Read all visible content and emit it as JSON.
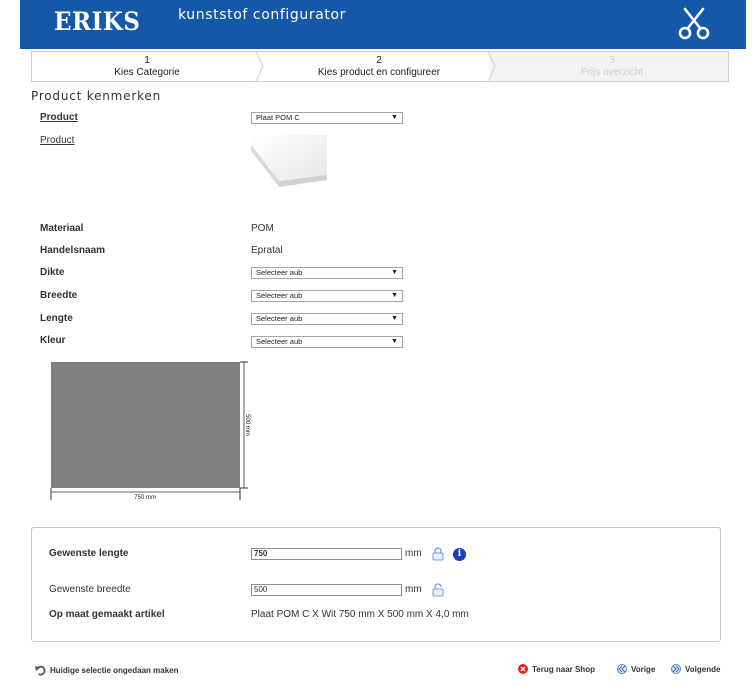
{
  "header": {
    "logo": "ERIKS",
    "title": "kunststof configurator",
    "icon": "scissors-icon",
    "color": "#1558a8"
  },
  "steps": [
    {
      "num": "1",
      "label": "Kies Categorie",
      "state": "done"
    },
    {
      "num": "2",
      "label": "Kies product en configureer",
      "state": "active"
    },
    {
      "num": "3",
      "label": "Prijs overzicht",
      "state": "disabled"
    }
  ],
  "section_title": "Product kenmerken",
  "product": {
    "label": "Product",
    "select_value": "Plaat POM C",
    "image_label": "Product"
  },
  "specs": {
    "materiaal_label": "Materiaal",
    "materiaal_value": "POM",
    "handelsnaam_label": "Handelsnaam",
    "handelsnaam_value": "Epratal",
    "dikte_label": "Dikte",
    "dikte_value": "Selecteer aub",
    "breedte_label": "Breedte",
    "breedte_value": "Selecteer aub",
    "lengte_label": "Lengte",
    "lengte_value": "Selecteer aub",
    "kleur_label": "Kleur",
    "kleur_value": "Selecteer aub"
  },
  "diagram": {
    "width_label": "750 mm",
    "height_label": "500 mm",
    "fill": "#7f7f7f"
  },
  "panel": {
    "lengte_label": "Gewenste lengte",
    "lengte_value": "750",
    "breedte_label": "Gewenste breedte",
    "breedte_value": "500",
    "unit": "mm",
    "artikel_label": "Op maat gemaakt artikel",
    "artikel_value": "Plaat POM C X Wit 750 mm X 500 mm X 4,0 mm"
  },
  "footer": {
    "undo": "Huidige selectie ongedaan maken",
    "back_shop": "Terug naar Shop",
    "prev": "Vorige",
    "next": "Volgende"
  }
}
